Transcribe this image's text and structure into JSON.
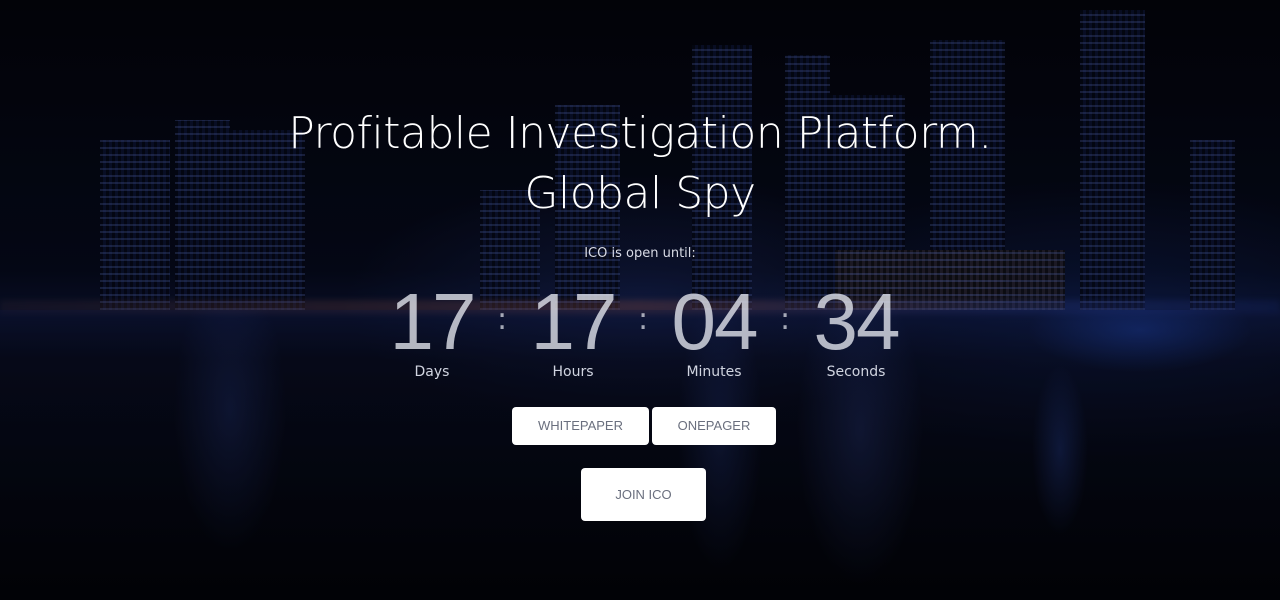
{
  "hero": {
    "title_line1": "Profitable Investigation Platform.",
    "title_line2": "Global Spy",
    "ico_label": "ICO is open until:"
  },
  "countdown": {
    "days": {
      "value": "17",
      "label": "Days"
    },
    "hours": {
      "value": "17",
      "label": "Hours"
    },
    "minutes": {
      "value": "04",
      "label": "Minutes"
    },
    "seconds": {
      "value": "34",
      "label": "Seconds"
    },
    "separator": ":"
  },
  "buttons": {
    "whitepaper": "WHITEPAPER",
    "onepager": "ONEPAGER",
    "join_ico": "JOIN ICO"
  },
  "colors": {
    "background": "#04050d",
    "button_bg": "#ffffff",
    "button_text": "#6a6f7e",
    "accent_blue": "#2a4ad8"
  }
}
